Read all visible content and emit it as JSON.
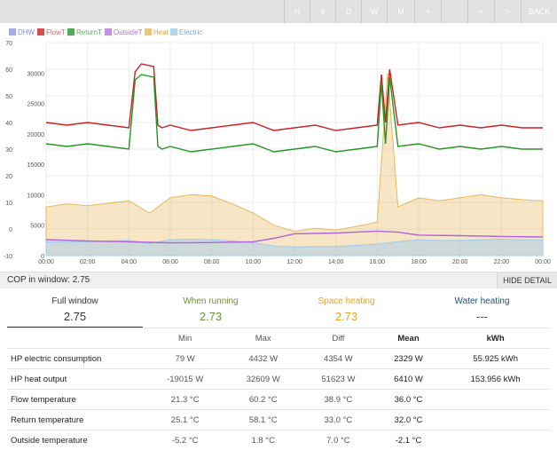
{
  "toolbar": {
    "buttons": [
      "H",
      "6",
      "D",
      "W",
      "M",
      "+",
      "-",
      "<",
      ">",
      "BACK"
    ]
  },
  "legend": [
    "DHW",
    "FlowT",
    "ReturnT",
    "OutsideT",
    "Heat",
    "Electric"
  ],
  "colors": {
    "dhw": "#6f6fcf",
    "flowT": "#cc2222",
    "returnT": "#229922",
    "outsideT": "#b060e0",
    "heat": "#e6b85c",
    "electric": "#9ccaf0",
    "tab_running": "#6d8f3a",
    "tab_space": "#e8a318",
    "tab_water": "#1f4f73"
  },
  "chart_data": {
    "type": "line",
    "x_ticks": [
      "00:00",
      "02:00",
      "04:00",
      "06:00",
      "08:00",
      "10:00",
      "12:00",
      "14:00",
      "16:00",
      "18:00",
      "20:00",
      "22:00",
      "00:00"
    ],
    "y_left_ticks": [
      70,
      60,
      50,
      40,
      30,
      20,
      10,
      0,
      -10
    ],
    "y_right_ticks": [
      30000,
      25000,
      20000,
      15000,
      10000,
      5000,
      0
    ],
    "ylim_left": [
      -10,
      70
    ],
    "ylim_right": [
      0,
      35000
    ],
    "series": [
      {
        "name": "FlowT",
        "axis": "left",
        "x": [
          0,
          1,
          2,
          3,
          4,
          4.3,
          4.6,
          5.2,
          5.4,
          5.6,
          6,
          7,
          8,
          9,
          10,
          11,
          12,
          13,
          14,
          15,
          16.0,
          16.2,
          16.4,
          16.6,
          17,
          18,
          19,
          20,
          21,
          22,
          23,
          24
        ],
        "y": [
          40,
          39,
          40,
          39,
          38,
          59,
          62,
          61,
          39,
          38,
          39,
          37,
          38,
          39,
          40,
          37,
          38,
          39,
          37,
          38,
          39,
          58,
          40,
          60,
          39,
          40,
          38,
          39,
          38,
          39,
          38,
          38
        ]
      },
      {
        "name": "ReturnT",
        "axis": "left",
        "x": [
          0,
          1,
          2,
          3,
          4,
          4.3,
          4.6,
          5.2,
          5.4,
          5.6,
          6,
          7,
          8,
          9,
          10,
          11,
          12,
          13,
          14,
          15,
          16.0,
          16.2,
          16.4,
          16.6,
          17,
          18,
          19,
          20,
          21,
          22,
          23,
          24
        ],
        "y": [
          32,
          31,
          32,
          31,
          30,
          56,
          58,
          57,
          31,
          30,
          31,
          29,
          30,
          31,
          32,
          29,
          30,
          31,
          29,
          30,
          31,
          55,
          32,
          57,
          31,
          32,
          30,
          31,
          30,
          31,
          30,
          30
        ]
      },
      {
        "name": "OutsideT",
        "axis": "left",
        "x": [
          0,
          2,
          4,
          5,
          6,
          8,
          10,
          11,
          12,
          14,
          16,
          17,
          18,
          20,
          22,
          24
        ],
        "y": [
          -4,
          -4.5,
          -4.8,
          -5,
          -5.2,
          -5.1,
          -4.8,
          -3.5,
          -1.8,
          -1.5,
          -0.8,
          -1.2,
          -2.3,
          -2.5,
          -2.8,
          -3.0
        ]
      },
      {
        "name": "Heat",
        "axis": "right",
        "x": [
          0,
          1,
          2,
          3,
          4,
          5,
          6,
          7,
          8,
          9,
          10,
          11,
          12,
          13,
          14,
          15,
          16,
          16.5,
          17,
          18,
          19,
          20,
          21,
          22,
          23,
          24
        ],
        "y": [
          8000,
          8500,
          8200,
          8600,
          9000,
          7000,
          9500,
          10000,
          9800,
          8500,
          7000,
          5000,
          4000,
          4500,
          4200,
          4800,
          5500,
          30000,
          8000,
          9500,
          9000,
          9500,
          10000,
          9500,
          9200,
          9000
        ]
      },
      {
        "name": "Electric",
        "axis": "right",
        "x": [
          0,
          1,
          2,
          3,
          4,
          5,
          6,
          7,
          8,
          9,
          10,
          11,
          12,
          13,
          14,
          15,
          16,
          17,
          18,
          19,
          20,
          21,
          22,
          23,
          24
        ],
        "y": [
          2300,
          2200,
          2300,
          2400,
          2500,
          2000,
          2600,
          2700,
          2600,
          2400,
          2100,
          1600,
          1400,
          1500,
          1500,
          1700,
          1900,
          2300,
          2600,
          2500,
          2500,
          2600,
          2700,
          2600,
          2600
        ]
      }
    ]
  },
  "cop": {
    "label": "COP in window: 2.75",
    "hide_label": "HIDE DETAIL"
  },
  "tabs": [
    {
      "label": "Full window",
      "value": "2.75"
    },
    {
      "label": "When running",
      "value": "2.73"
    },
    {
      "label": "Space heating",
      "value": "2.73"
    },
    {
      "label": "Water heating",
      "value": "---"
    }
  ],
  "table": {
    "headers": [
      "",
      "Min",
      "Max",
      "Diff",
      "Mean",
      "kWh"
    ],
    "rows": [
      [
        "HP electric consumption",
        "79 W",
        "4432 W",
        "4354 W",
        "2329 W",
        "55.925 kWh"
      ],
      [
        "HP heat output",
        "-19015 W",
        "32609 W",
        "51623 W",
        "6410 W",
        "153.956 kWh"
      ],
      [
        "Flow temperature",
        "21.3 °C",
        "60.2 °C",
        "38.9 °C",
        "36.0 °C",
        ""
      ],
      [
        "Return temperature",
        "25.1 °C",
        "58.1 °C",
        "33.0 °C",
        "32.0 °C",
        ""
      ],
      [
        "Outside temperature",
        "-5.2 °C",
        "1.8 °C",
        "7.0 °C",
        "-2.1 °C",
        ""
      ]
    ]
  }
}
